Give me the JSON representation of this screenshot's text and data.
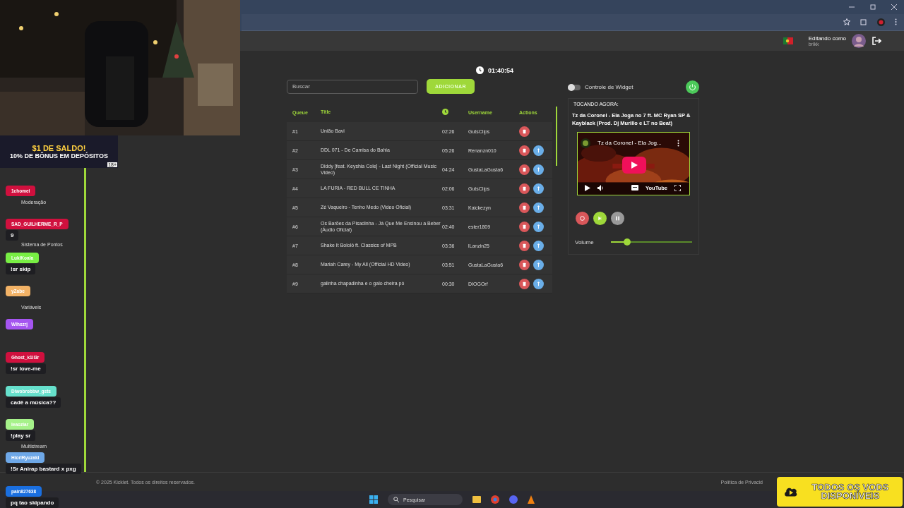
{
  "banner": {
    "line_1": "$1 DE SALDO!",
    "line_2": "10% DE BÔNUS EM DEPÓSITOS",
    "age": "18+"
  },
  "header": {
    "editing_label": "Editando como",
    "username": "brikk"
  },
  "sidebar": {
    "items": [
      {
        "label": "Moderação"
      },
      {
        "label": "Sistema de Pontos"
      },
      {
        "label": "Variáveis"
      },
      {
        "label": "Multistream"
      }
    ]
  },
  "timer": "01:40:54",
  "search": {
    "placeholder": "Buscar"
  },
  "add_button": "ADICIONAR",
  "table": {
    "columns": [
      "Queue",
      "Title",
      "Username",
      "Actions"
    ],
    "rows": [
      {
        "queue": "#1",
        "title": "União Bavi",
        "duration": "02:26",
        "username": "GutsClips",
        "can_move_up": false
      },
      {
        "queue": "#2",
        "title": "DDL 071 - De Camisa do Bahia",
        "duration": "05:26",
        "username": "Renanzn010",
        "can_move_up": true
      },
      {
        "queue": "#3",
        "title": "Diddy [feat. Keyshia Cole] - Last Night (Official Music Video)",
        "duration": "04:24",
        "username": "GustaLaGusta6",
        "can_move_up": true
      },
      {
        "queue": "#4",
        "title": "LA FURIA - RED BULL CE TINHA",
        "duration": "02:06",
        "username": "GutsClips",
        "can_move_up": true
      },
      {
        "queue": "#5",
        "title": "Zé Vaqueiro - Tenho Medo (Video Oficial)",
        "duration": "03:31",
        "username": "Kaickezyn",
        "can_move_up": true
      },
      {
        "queue": "#6",
        "title": "Os Barões da Pisadinha - Já Que Me Ensinou a Beber (Áudio Oficial)",
        "duration": "02:40",
        "username": "ester1809",
        "can_move_up": true
      },
      {
        "queue": "#7",
        "title": "Shake It Bololô ft. Classics of MPB",
        "duration": "03:36",
        "username": "lLanzin25",
        "can_move_up": true
      },
      {
        "queue": "#8",
        "title": "Mariah Carey - My All (Official HD Video)",
        "duration": "03:51",
        "username": "GustaLaGusta6",
        "can_move_up": true
      },
      {
        "queue": "#9",
        "title": "galinha chapadinha e o galo cheira pó",
        "duration": "00:30",
        "username": "DIOGOrf",
        "can_move_up": true
      }
    ]
  },
  "widget": {
    "label": "Controle de Widget",
    "on": false
  },
  "now_playing": {
    "heading": "TOCANDO AGORA:",
    "title": "Tz da Coronel - Ela Joga no 7 ft. MC Ryan SP & Kayblack (Prod. Dj Murillo e LT no Beat)",
    "video_title": "Tz da Coronel - Ela Jog...",
    "video_brand": "YouTube",
    "volume_label": "Volume",
    "level": 0.2
  },
  "chat": [
    {
      "user": "1chomei",
      "color": "#d0103e"
    },
    {
      "user": "SAD_GUILHERME_R_P",
      "color": "#d0103e",
      "text": "9"
    },
    {
      "user": "LukiKoala",
      "color": "#78ee44",
      "text": "!sr skip"
    },
    {
      "user": "yZabe",
      "color": "#f2b266"
    },
    {
      "user": "Wlhszrj",
      "color": "#a555f0"
    },
    {
      "user": "Ghost_k1ll3r",
      "color": "#d0103e",
      "text": "!sr love-me"
    },
    {
      "user": "Diwobrobbw_gsts",
      "color": "#66e0cc",
      "text": "cadê a música??"
    },
    {
      "user": "Ieaoziar",
      "color": "#a6f28a",
      "text": "!play sr"
    },
    {
      "user": "HioriRyuzaki",
      "color": "#6ea8e8",
      "text": "!Sr Anirap bastard x pxg"
    },
    {
      "user": "pain827638",
      "color": "#1a6fe0",
      "text": "pq tao skipando"
    }
  ],
  "footer": {
    "copyright": "© 2025 Kicklet. Todos os direitos reservados.",
    "privacy": "Política de Privacid"
  },
  "taskbar": {
    "search": "Pesquisar"
  },
  "vods_badge": "TODOS OS VODS DISPONÍVEIS"
}
